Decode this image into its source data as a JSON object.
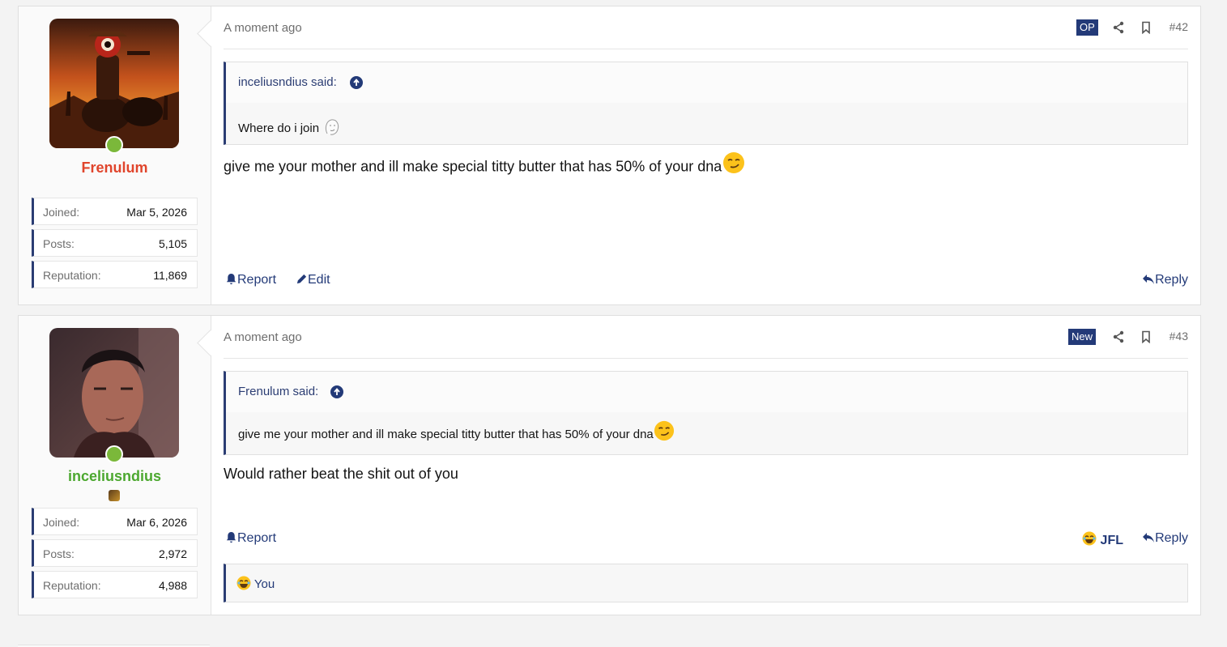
{
  "posts": [
    {
      "user": {
        "name": "Frenulum",
        "name_color": "#e0452c",
        "stats": [
          {
            "label": "Joined:",
            "value": "Mar 5, 2026"
          },
          {
            "label": "Posts:",
            "value": "5,105"
          },
          {
            "label": "Reputation:",
            "value": "11,869"
          }
        ]
      },
      "time": "A moment ago",
      "badge": "OP",
      "number": "#42",
      "quote": {
        "author": "inceliusndius said:",
        "text": "Where do i join"
      },
      "body": "give me your mother and ill make special titty butter that has 50% of your dna",
      "actions": {
        "report": "Report",
        "edit": "Edit",
        "reply": "Reply"
      }
    },
    {
      "user": {
        "name": "inceliusndius",
        "name_color": "#4ca82f",
        "stats": [
          {
            "label": "Joined:",
            "value": "Mar 6, 2026"
          },
          {
            "label": "Posts:",
            "value": "2,972"
          },
          {
            "label": "Reputation:",
            "value": "4,988"
          }
        ]
      },
      "time": "A moment ago",
      "badge": "New",
      "number": "#43",
      "quote": {
        "author": "Frenulum said:",
        "text": "give me your mother and ill make special titty butter that has 50% of your dna"
      },
      "body": "Would rather beat the shit out of you",
      "actions": {
        "report": "Report",
        "reaction": "JFL",
        "reply": "Reply"
      },
      "reactions_summary": "You"
    }
  ],
  "colors": {
    "accent": "#233a78",
    "online": "#7bb83a"
  },
  "icons": [
    "share-icon",
    "bookmark-icon",
    "arrow-up-circle-icon",
    "bell-icon",
    "pencil-icon",
    "reply-icon",
    "smirk-emoji-icon",
    "crying-laughing-emoji-icon",
    "wojak-icon"
  ]
}
